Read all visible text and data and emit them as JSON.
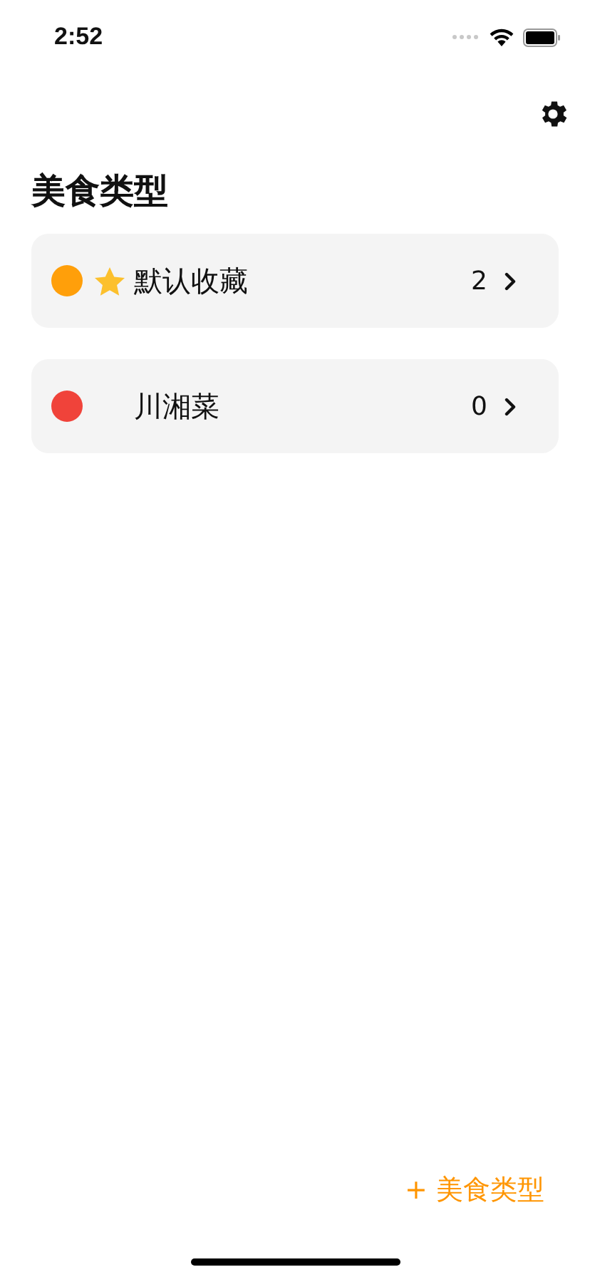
{
  "status_bar": {
    "time": "2:52"
  },
  "title": "美食类型",
  "categories": [
    {
      "name": "默认收藏",
      "count": "2",
      "color": "#ff9f0a",
      "favorite": true
    },
    {
      "name": "川湘菜",
      "count": "0",
      "color": "#f0433a",
      "favorite": false
    }
  ],
  "add_button": {
    "label": "+ 美食类型"
  }
}
